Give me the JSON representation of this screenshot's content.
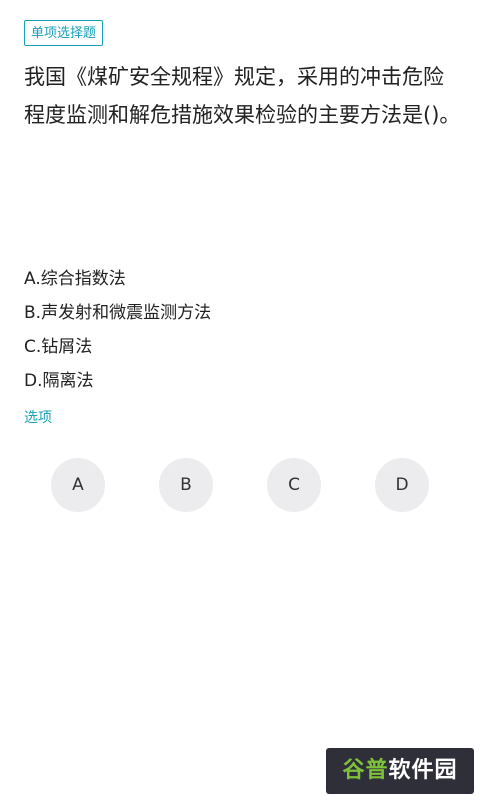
{
  "question": {
    "type_tag": "单项选择题",
    "text": "我国《煤矿安全规程》规定，采用的冲击危险程度监测和解危措施效果检验的主要方法是()。"
  },
  "options": [
    {
      "text": "A.综合指数法"
    },
    {
      "text": "B.声发射和微震监测方法"
    },
    {
      "text": "C.钻屑法"
    },
    {
      "text": "D.隔离法"
    }
  ],
  "answer_section": {
    "label": "选项",
    "choices": [
      "A",
      "B",
      "C",
      "D"
    ]
  },
  "watermark": {
    "brand_prefix": "谷普",
    "brand_suffix": "软件园"
  }
}
